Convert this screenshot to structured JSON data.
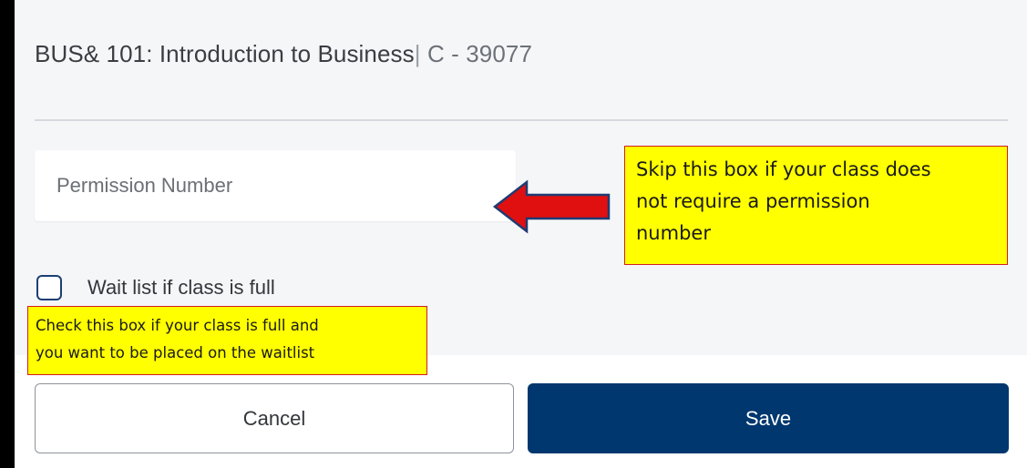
{
  "course": {
    "title_main": "BUS& 101: Introduction to Business",
    "separator": "|",
    "section": "C - 39077"
  },
  "form": {
    "permission_placeholder": "Permission Number",
    "permission_value": "",
    "waitlist_label": "Wait list if class is full",
    "waitlist_checked": false,
    "cancel_label": "Cancel",
    "save_label": "Save"
  },
  "annotations": {
    "permission_note_lines": [
      "Skip this box if your class does",
      "not require a permission",
      "number"
    ],
    "waitlist_note_lines": [
      "Check this box if your class is full and",
      "you want to be placed on the waitlist"
    ]
  },
  "colors": {
    "primary": "#00376e",
    "callout_bg": "#ffff00",
    "callout_border": "#d02020",
    "arrow": "#e01010",
    "arrow_outline": "#1f3b73"
  },
  "icons": {
    "arrow": "left-arrow-icon"
  }
}
